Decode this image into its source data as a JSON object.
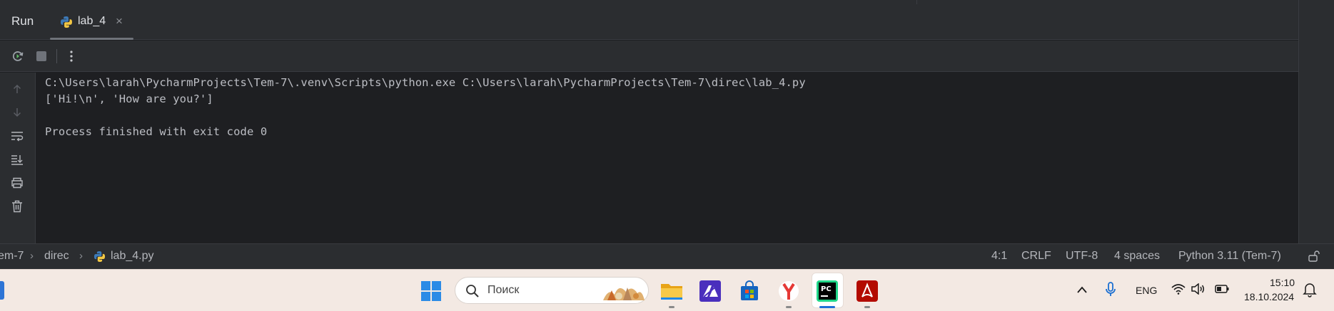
{
  "run_panel": {
    "title": "Run",
    "tab": {
      "label": "lab_4",
      "close_glyph": "×",
      "icon": "python-icon"
    }
  },
  "toolbar": {
    "buttons": [
      "rerun-icon",
      "stop-icon",
      "more-options-icon"
    ]
  },
  "gutter": {
    "buttons": [
      "arrow-up-icon",
      "arrow-down-icon",
      "soft-wrap-icon",
      "scroll-to-end-icon",
      "print-icon",
      "trash-icon"
    ]
  },
  "console": {
    "lines": [
      "C:\\Users\\larah\\PycharmProjects\\Tem-7\\.venv\\Scripts\\python.exe C:\\Users\\larah\\PycharmProjects\\Tem-7\\direc\\lab_4.py",
      "['Hi!\\n', 'How are you?']",
      "",
      "Process finished with exit code 0"
    ]
  },
  "status_bar": {
    "breadcrumb": [
      "em-7",
      "direc",
      "lab_4.py"
    ],
    "position": "4:1",
    "line_separator": "CRLF",
    "encoding": "UTF-8",
    "indent": "4 spaces",
    "interpreter": "Python 3.11 (Tem-7)"
  },
  "taskbar": {
    "search_placeholder": "Поиск",
    "apps": [
      "windows-start-icon",
      "file-explorer-icon",
      "visual-studio-icon",
      "microsoft-store-icon",
      "yandex-browser-icon",
      "pycharm-icon",
      "acrobat-reader-icon"
    ],
    "tray": {
      "language": "ENG",
      "time": "15:10",
      "date": "18.10.2024"
    }
  },
  "colors": {
    "editor_bg": "#1e1f22",
    "panel_bg": "#2b2d30",
    "text": "#bcbec4",
    "taskbar_bg": "#f3e9e3"
  }
}
